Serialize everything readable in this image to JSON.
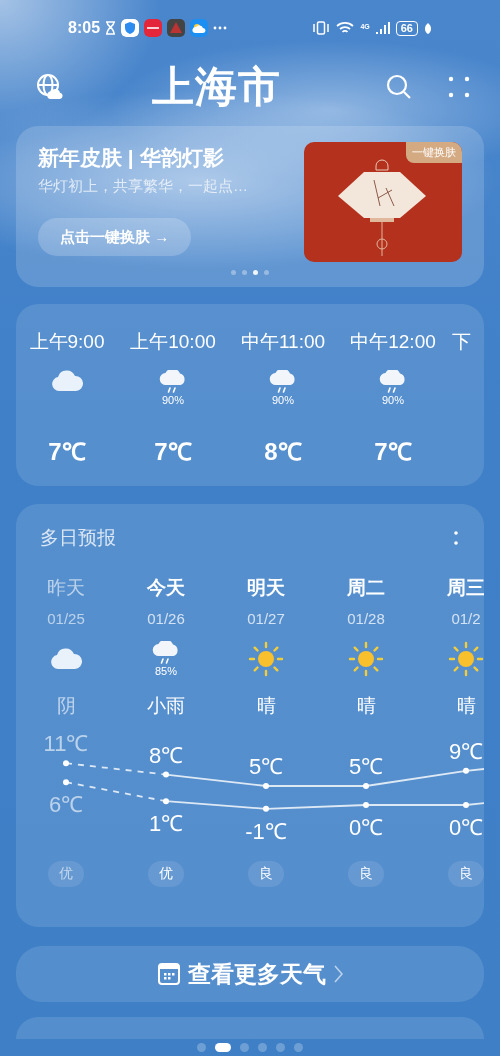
{
  "status_bar": {
    "time": "8:05",
    "network": "4G",
    "battery": "66"
  },
  "header": {
    "city": "上海市"
  },
  "banner": {
    "title": "新年皮肤 | 华韵灯影",
    "subtitle": "华灯初上，共享繁华，一起点…",
    "button": "点击一键换肤 →",
    "image_badge": "一键换肤",
    "pages": [
      {
        "selected": false
      },
      {
        "selected": false
      },
      {
        "selected": true
      },
      {
        "selected": false
      }
    ]
  },
  "hourly": [
    {
      "time": "上午9:00",
      "kind": "cloudy",
      "temp": "7℃"
    },
    {
      "time": "上午10:00",
      "kind": "rain",
      "precip": "90%",
      "temp": "7℃"
    },
    {
      "time": "中午11:00",
      "kind": "rain",
      "precip": "90%",
      "temp": "8℃"
    },
    {
      "time": "中午12:00",
      "kind": "rain",
      "precip": "90%",
      "temp": "7℃"
    },
    {
      "time": "下"
    }
  ],
  "daily": {
    "title": "多日预报",
    "days": [
      {
        "day": "昨天",
        "date": "01/25",
        "kind": "cloudy",
        "condition": "阴",
        "high": "11℃",
        "low": "6℃",
        "aqi": "优",
        "past": true
      },
      {
        "day": "今天",
        "date": "01/26",
        "kind": "rain",
        "precip": "85%",
        "condition": "小雨",
        "high": "8℃",
        "low": "1℃",
        "aqi": "优",
        "past": false
      },
      {
        "day": "明天",
        "date": "01/27",
        "kind": "sunny",
        "condition": "晴",
        "high": "5℃",
        "low": "-1℃",
        "aqi": "良",
        "past": false
      },
      {
        "day": "周二",
        "date": "01/28",
        "kind": "sunny",
        "condition": "晴",
        "high": "5℃",
        "low": "0℃",
        "aqi": "良",
        "past": false
      },
      {
        "day": "周三",
        "date": "01/2",
        "kind": "sunny",
        "condition": "晴",
        "high": "9℃",
        "low": "0℃",
        "aqi": "良",
        "past": false
      }
    ]
  },
  "more_button": {
    "label": "查看更多天气"
  },
  "page_indicator": [
    {
      "selected": false
    },
    {
      "selected": true
    },
    {
      "selected": false
    },
    {
      "selected": false
    },
    {
      "selected": false
    },
    {
      "selected": false
    }
  ]
}
